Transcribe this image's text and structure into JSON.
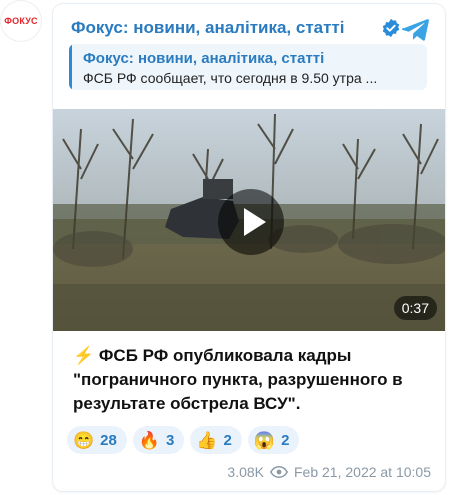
{
  "avatar": {
    "text": "ФОКУС",
    "color": "#e3262b"
  },
  "channel": {
    "title": "Фокус: новини, аналітика, статті",
    "verified_icon": "verified-badge-icon",
    "share_icon": "telegram-icon"
  },
  "quote": {
    "title": "Фокус: новини, аналітика, статті",
    "text": "ФСБ РФ сообщает, что сегодня в 9.50 утра ..."
  },
  "video": {
    "duration": "0:37",
    "play_icon": "play-icon"
  },
  "post": {
    "bolt": "⚡",
    "text": "ФСБ РФ опубликовала кадры \"пограничного пункта, разрушенного в результате обстрела ВСУ\"."
  },
  "reactions": [
    {
      "emoji": "😁",
      "count": "28"
    },
    {
      "emoji": "🔥",
      "count": "3"
    },
    {
      "emoji": "👍",
      "count": "2"
    },
    {
      "emoji": "😱",
      "count": "2"
    }
  ],
  "meta": {
    "views": "3.08K",
    "date": "Feb 21, 2022 at 10:05"
  },
  "colors": {
    "accent": "#2a7bbf",
    "quote_bg": "#eef6fc"
  }
}
